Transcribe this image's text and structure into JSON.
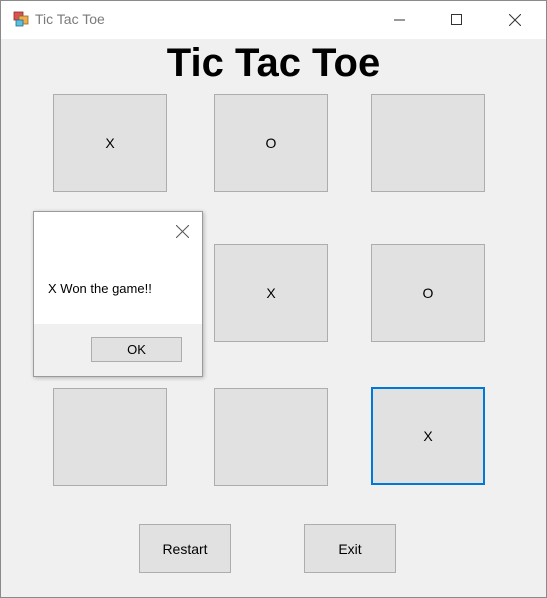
{
  "window": {
    "title": "Tic Tac Toe",
    "icon": "winforms-app-icon"
  },
  "game": {
    "heading": "Tic Tac Toe",
    "board": [
      [
        "X",
        "O",
        ""
      ],
      [
        "",
        "X",
        "O"
      ],
      [
        "",
        "",
        "X"
      ]
    ],
    "focused_cell": "row3-col3"
  },
  "buttons": {
    "restart": "Restart",
    "exit": "Exit"
  },
  "dialog": {
    "message": "X Won the game!!",
    "ok": "OK"
  },
  "colors": {
    "focus_border": "#0078d7",
    "cell_bg": "#e1e1e1",
    "window_bg": "#f0f0f0"
  }
}
